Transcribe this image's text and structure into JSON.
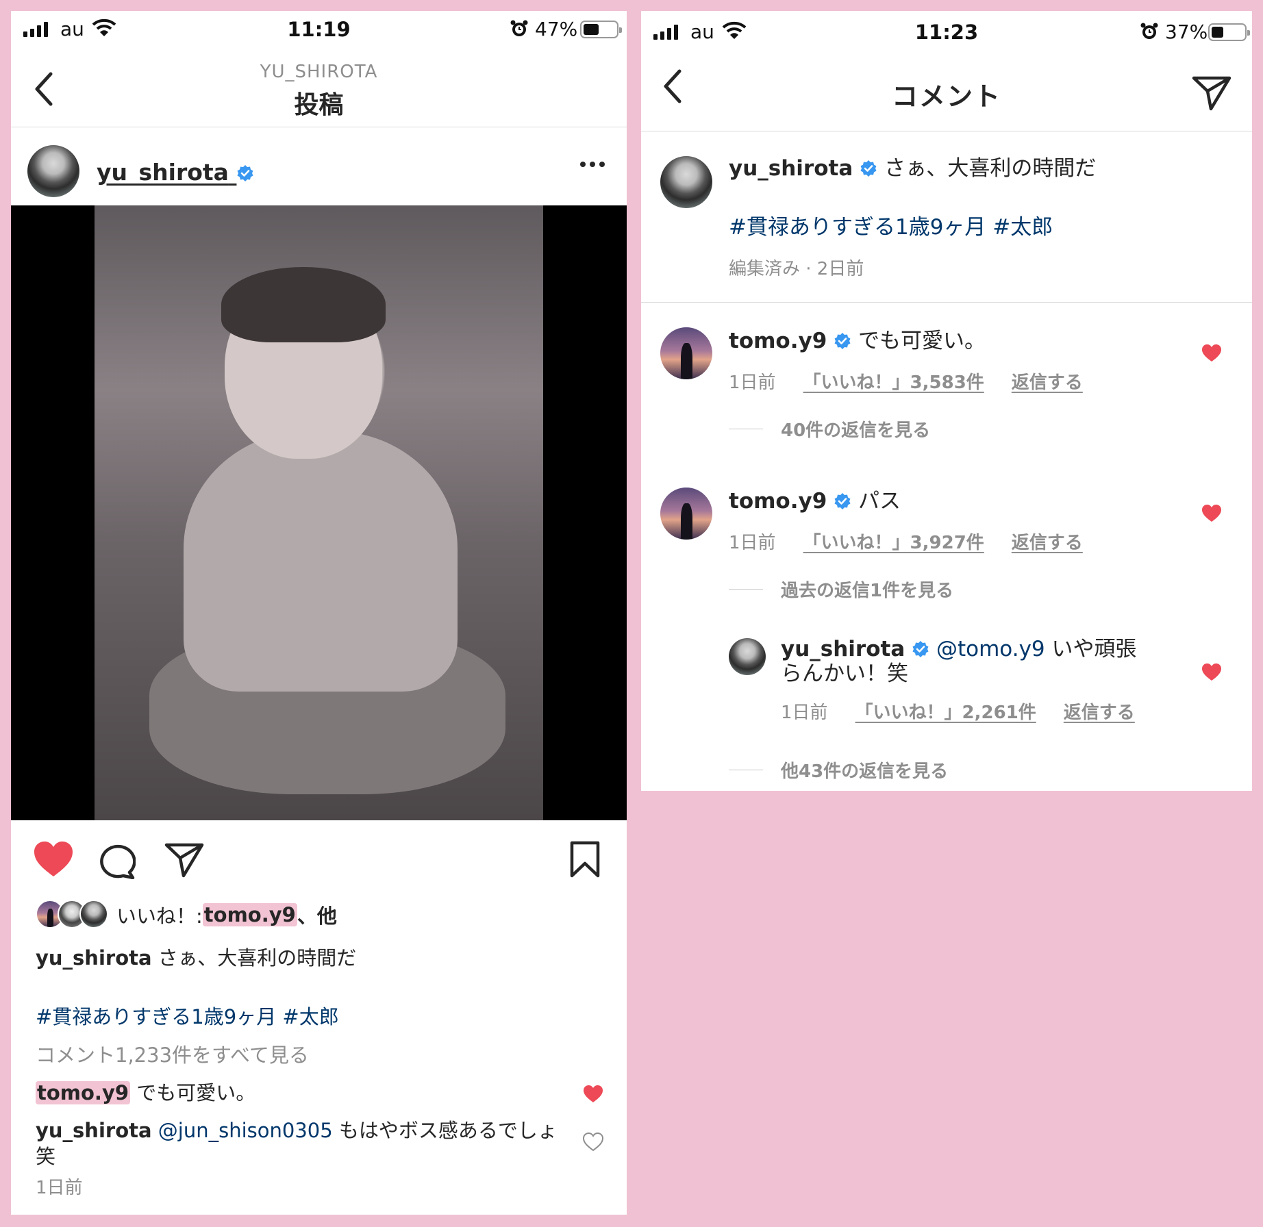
{
  "left": {
    "status": {
      "carrier": "au",
      "time": "11:19",
      "battery": "47%",
      "battery_level": 0.47
    },
    "nav": {
      "subtitle": "YU_SHIROTA",
      "title": "投稿"
    },
    "post": {
      "username": "yu_shirota",
      "likes_label": "いいね！: ",
      "likes_user": "tomo.y9",
      "likes_suffix": "、他",
      "caption_user": "yu_shirota",
      "caption_text": " さぁ、大喜利の時間だ",
      "hashtags": "#貫禄ありすぎる1歳9ヶ月 #太郎",
      "view_all_comments": "コメント1,233件をすべて見る",
      "comments": [
        {
          "user": "tomo.y9",
          "text": " でも可愛い。"
        },
        {
          "user": "yu_shirota",
          "mention": " @jun_shison0305",
          "text": " もはやボス感あるでしょ笑"
        }
      ],
      "timestamp": "1日前"
    }
  },
  "right": {
    "status": {
      "carrier": "au",
      "time": "11:23",
      "battery": "37%",
      "battery_level": 0.37
    },
    "nav": {
      "title": "コメント"
    },
    "caption": {
      "user": "yu_shirota",
      "text": " さぁ、大喜利の時間だ",
      "hashtags": "#貫禄ありすぎる1歳9ヶ月 #太郎",
      "meta": "編集済み · 2日前"
    },
    "comments": [
      {
        "user": "tomo.y9",
        "text": " でも可愛い。",
        "time": "1日前",
        "likes": "「いいね！」3,583件",
        "reply": "返信する",
        "view_replies": "40件の返信を見る"
      },
      {
        "user": "tomo.y9",
        "text": " パス",
        "time": "1日前",
        "likes": "「いいね！」3,927件",
        "reply": "返信する",
        "view_replies": "過去の返信1件を見る"
      }
    ],
    "reply": {
      "user": "yu_shirota",
      "mention": " @tomo.y9",
      "text": " いや頑張らんかい！笑",
      "time": "1日前",
      "likes": "「いいね！」2,261件",
      "reply": "返信する",
      "view_replies": "他43件の返信を見る"
    }
  },
  "colors": {
    "background": "#f0c1d2",
    "heart": "#ed4956",
    "verified": "#3897f0",
    "hashtag": "#00376b",
    "highlight": "#f2c3d3"
  },
  "icons": [
    "signal-icon",
    "wifi-icon",
    "alarm-icon",
    "battery-icon",
    "back-icon",
    "verified-icon",
    "more-icon",
    "heart-icon",
    "comment-icon",
    "send-icon",
    "bookmark-icon"
  ]
}
